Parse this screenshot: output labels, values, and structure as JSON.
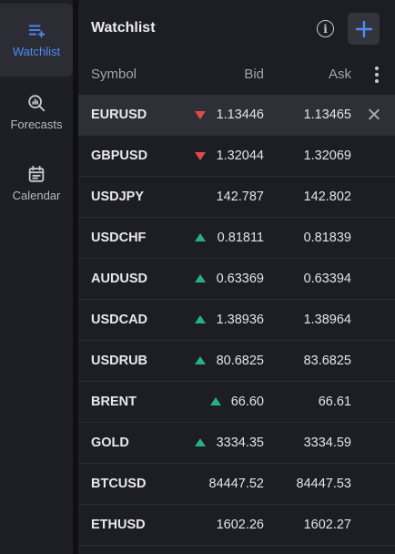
{
  "sidebar": {
    "items": [
      {
        "label": "Watchlist",
        "icon": "watchlist-icon",
        "active": true
      },
      {
        "label": "Forecasts",
        "icon": "forecasts-icon",
        "active": false
      },
      {
        "label": "Calendar",
        "icon": "calendar-icon",
        "active": false
      }
    ]
  },
  "panel": {
    "title": "Watchlist",
    "info_icon": "info-icon",
    "add_icon": "plus-icon",
    "info_glyph": "i"
  },
  "columns": {
    "symbol": "Symbol",
    "bid": "Bid",
    "ask": "Ask",
    "menu_icon": "more-vertical-icon"
  },
  "colors": {
    "accent": "#4d8cf5",
    "down": "#e04a4a",
    "up": "#26b08a"
  },
  "rows": [
    {
      "symbol": "EURUSD",
      "bid": "1.13446",
      "ask": "1.13465",
      "trend": "down",
      "selected": true
    },
    {
      "symbol": "GBPUSD",
      "bid": "1.32044",
      "ask": "1.32069",
      "trend": "down",
      "selected": false
    },
    {
      "symbol": "USDJPY",
      "bid": "142.787",
      "ask": "142.802",
      "trend": "none",
      "selected": false
    },
    {
      "symbol": "USDCHF",
      "bid": "0.81811",
      "ask": "0.81839",
      "trend": "up",
      "selected": false
    },
    {
      "symbol": "AUDUSD",
      "bid": "0.63369",
      "ask": "0.63394",
      "trend": "up",
      "selected": false
    },
    {
      "symbol": "USDCAD",
      "bid": "1.38936",
      "ask": "1.38964",
      "trend": "up",
      "selected": false
    },
    {
      "symbol": "USDRUB",
      "bid": "80.6825",
      "ask": "83.6825",
      "trend": "up",
      "selected": false
    },
    {
      "symbol": "BRENT",
      "bid": "66.60",
      "ask": "66.61",
      "trend": "up",
      "selected": false
    },
    {
      "symbol": "GOLD",
      "bid": "3334.35",
      "ask": "3334.59",
      "trend": "up",
      "selected": false
    },
    {
      "symbol": "BTCUSD",
      "bid": "84447.52",
      "ask": "84447.53",
      "trend": "none",
      "selected": false
    },
    {
      "symbol": "ETHUSD",
      "bid": "1602.26",
      "ask": "1602.27",
      "trend": "none",
      "selected": false
    }
  ]
}
